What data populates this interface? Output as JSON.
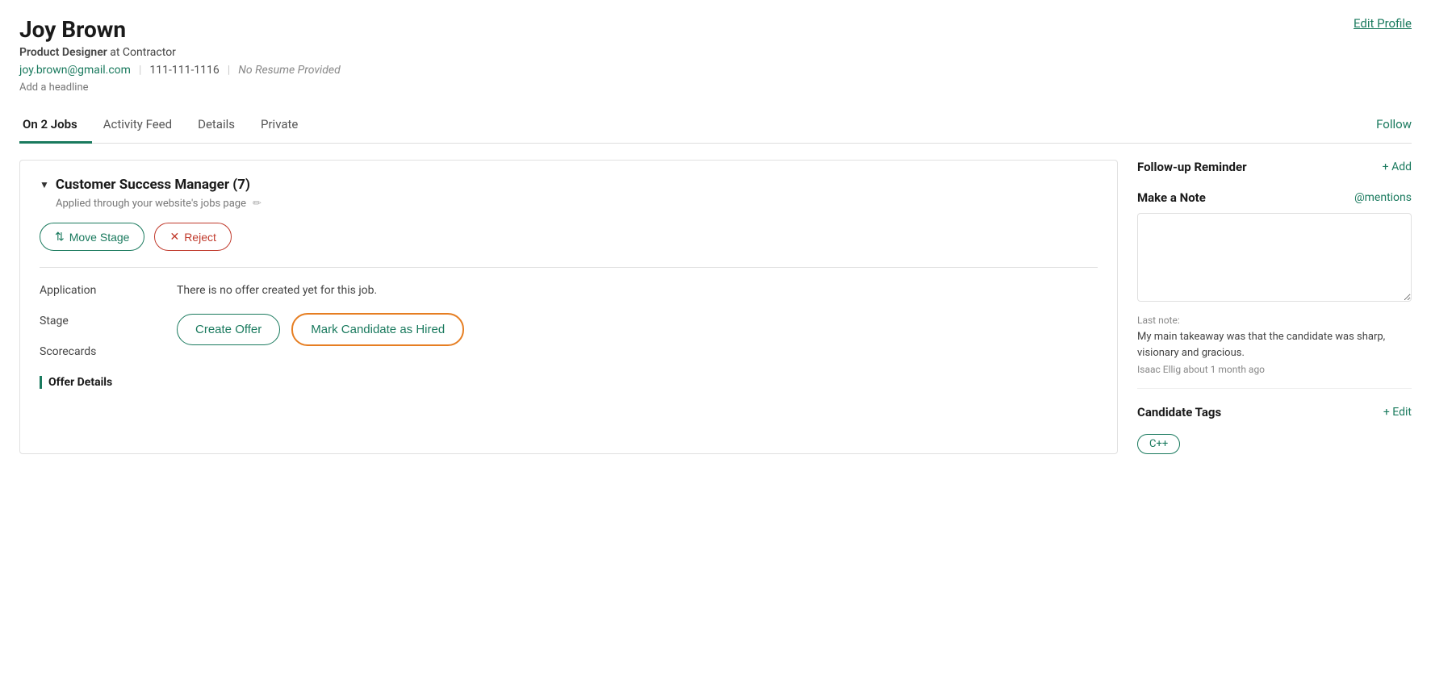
{
  "header": {
    "candidate_name": "Joy Brown",
    "edit_profile_label": "Edit Profile",
    "title_bold": "Product Designer",
    "title_rest": " at Contractor",
    "email": "joy.brown@gmail.com",
    "phone": "111-111-1116",
    "no_resume": "No Resume Provided",
    "add_headline": "Add a headline"
  },
  "tabs": [
    {
      "label": "On 2 Jobs",
      "active": true
    },
    {
      "label": "Activity Feed",
      "active": false
    },
    {
      "label": "Details",
      "active": false
    },
    {
      "label": "Private",
      "active": false
    }
  ],
  "follow_label": "Follow",
  "job_section": {
    "title": "Customer Success Manager (7)",
    "applied_through": "Applied through your website's jobs page",
    "move_stage_label": "Move Stage",
    "reject_label": "Reject",
    "no_offer_text": "There is no offer created yet for this job.",
    "create_offer_label": "Create Offer",
    "mark_hired_label": "Mark Candidate as Hired"
  },
  "side_nav": [
    {
      "label": "Application",
      "active": false
    },
    {
      "label": "Stage",
      "active": false
    },
    {
      "label": "Scorecards",
      "active": false
    },
    {
      "label": "Offer Details",
      "active": true
    }
  ],
  "right_panel": {
    "followup_title": "Follow-up Reminder",
    "add_label": "+ Add",
    "make_note_title": "Make a Note",
    "mentions_label": "@mentions",
    "note_placeholder": "",
    "last_note_label": "Last note:",
    "last_note_text": "My main takeaway was that the candidate was sharp, visionary and gracious.",
    "last_note_author": "Isaac Ellig about 1 month ago",
    "candidate_tags_title": "Candidate Tags",
    "edit_tags_label": "+ Edit",
    "tags": [
      "C++"
    ]
  }
}
